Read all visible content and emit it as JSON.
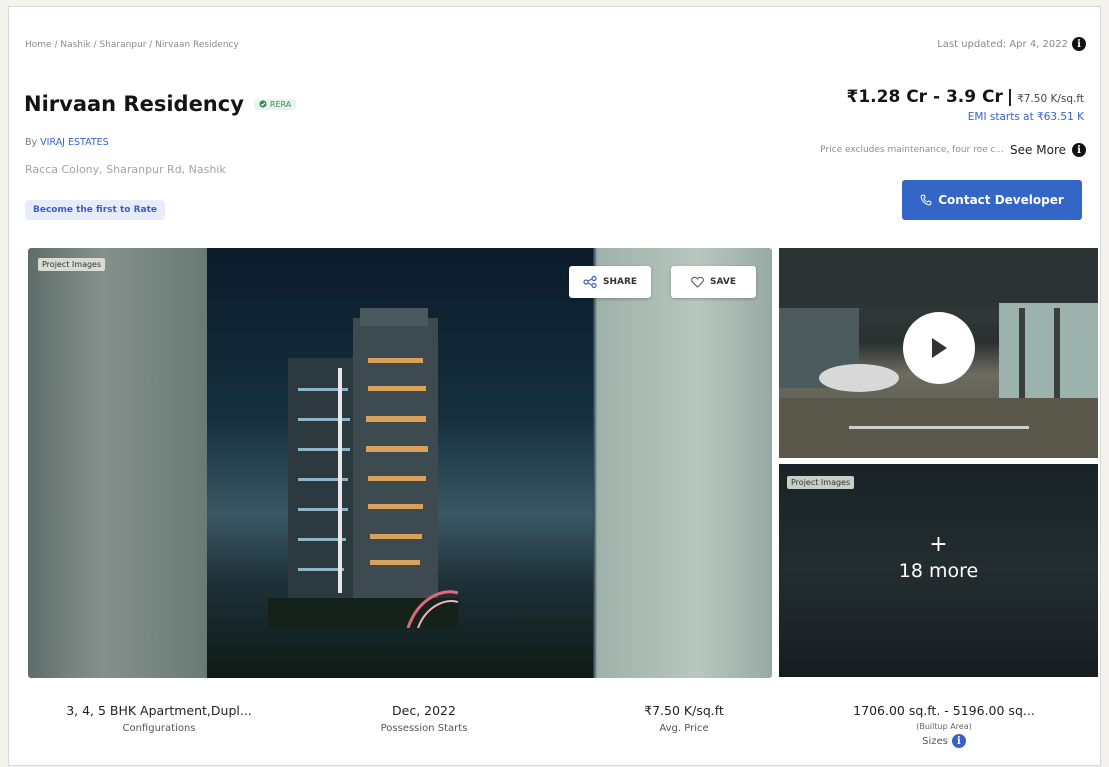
{
  "breadcrumb": "Home / Nashik / Sharanpur / Nirvaan Residency",
  "last_updated": "Last updated: Apr 4, 2022",
  "project": {
    "title": "Nirvaan Residency",
    "rera": "RERA",
    "by_label": "By",
    "developer": "VIRAJ ESTATES",
    "address": "Racca Colony, Sharanpur Rd, Nashik",
    "rate_chip": "Become the first to Rate"
  },
  "price": {
    "range": "₹1.28 Cr - 3.9 Cr",
    "separator": "|",
    "per_sqft": "₹7.50 K/sq.ft",
    "emi": "EMI starts at ₹63.51 K",
    "excludes": "Price excludes maintenance, four roe c...",
    "see_more": "See More"
  },
  "contact_button": "Contact Developer",
  "gallery": {
    "tag_main": "Project Images",
    "share": "SHARE",
    "save": "SAVE",
    "tag_more": "Project Images",
    "more_plus": "+",
    "more_label": "18 more"
  },
  "stats": [
    {
      "value": "3, 4, 5 BHK Apartment,Dupl...",
      "label": "Configurations"
    },
    {
      "value": "Dec, 2022",
      "label": "Possession Starts"
    },
    {
      "value": "₹7.50 K/sq.ft",
      "label": "Avg. Price"
    },
    {
      "value": "1706.00 sq.ft. - 5196.00 sq...",
      "sub": "(Builtup Area)",
      "label": "Sizes"
    }
  ],
  "colors": {
    "accent": "#3466c8",
    "link": "#3a62c6",
    "chip_bg": "#e6ecfb"
  },
  "icons": [
    "info-icon",
    "rera-check-icon",
    "phone-icon",
    "share-icon",
    "heart-icon",
    "play-icon"
  ]
}
